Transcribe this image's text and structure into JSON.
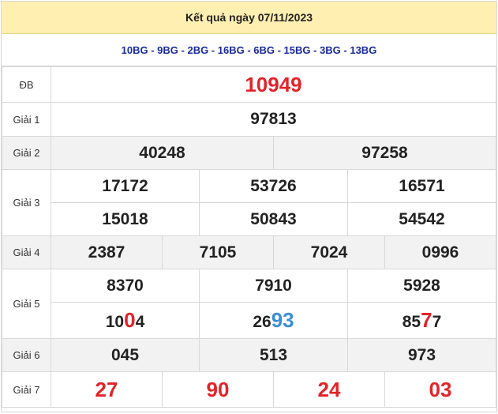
{
  "header": {
    "title": "Kết quả ngày 07/11/2023"
  },
  "provinces": "10BG - 9BG - 2BG - 16BG - 6BG - 15BG - 3BG - 13BG",
  "labels": {
    "db": "ĐB",
    "g1": "Giải 1",
    "g2": "Giải 2",
    "g3": "Giải 3",
    "g4": "Giải 4",
    "g5": "Giải 5",
    "g6": "Giải 6",
    "g7": "Giải 7"
  },
  "results": {
    "db": "10949",
    "g1": "97813",
    "g2": [
      "40248",
      "97258"
    ],
    "g3": [
      "17172",
      "53726",
      "16571",
      "15018",
      "50843",
      "54542"
    ],
    "g4": [
      "2387",
      "7105",
      "7024",
      "0996"
    ],
    "g5_top": [
      "8370",
      "7910",
      "5928"
    ],
    "g5_bottom": [
      {
        "pre": "10",
        "hl": "0",
        "post": "4",
        "color": "#e2232a"
      },
      {
        "pre": "26",
        "hl": "93",
        "post": "",
        "color": "#3b8fd8"
      },
      {
        "pre": "85",
        "hl": "7",
        "post": "7",
        "color": "#e2232a"
      }
    ],
    "g6": [
      "045",
      "513",
      "973"
    ],
    "g7": [
      "27",
      "90",
      "24",
      "03"
    ]
  },
  "colors": {
    "header_bg": "#ffefb0",
    "province_text": "#1a2a9a",
    "highlight_red": "#e2232a",
    "highlight_blue": "#3b8fd8",
    "row_alt": "#f2f2f2"
  }
}
